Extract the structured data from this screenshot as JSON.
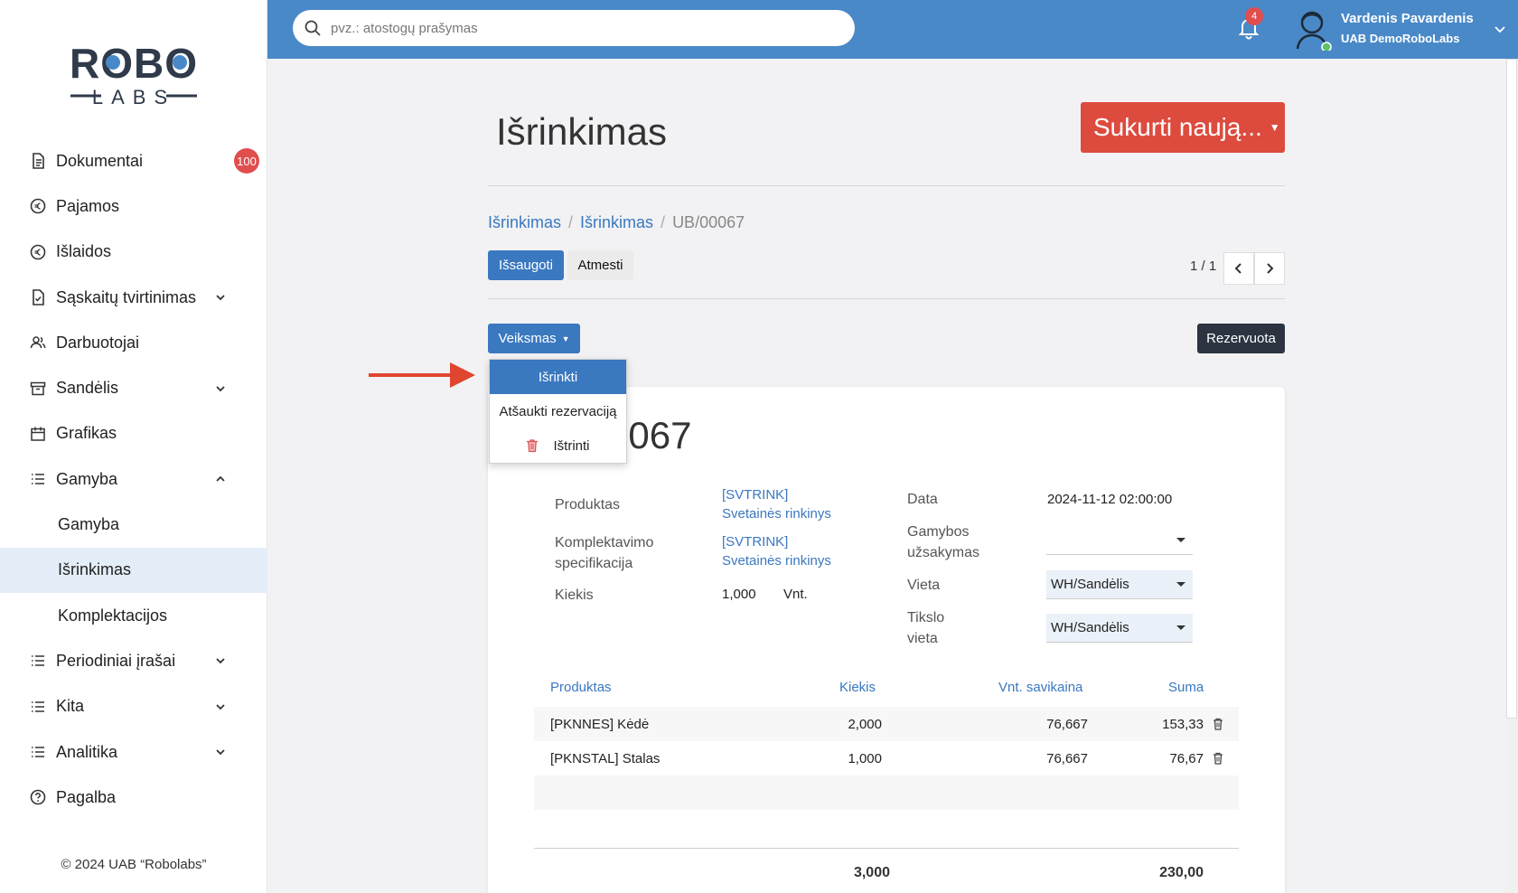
{
  "sidebar": {
    "logo": {
      "top": "ROBO",
      "bottom": "LABS"
    },
    "items": [
      {
        "label": "Dokumentai",
        "badge": "100"
      },
      {
        "label": "Pajamos"
      },
      {
        "label": "Išlaidos"
      },
      {
        "label": "Sąskaitų tvirtinimas"
      },
      {
        "label": "Darbuotojai"
      },
      {
        "label": "Sandėlis"
      },
      {
        "label": "Grafikas"
      },
      {
        "label": "Gamyba"
      },
      {
        "label": "Gamyba"
      },
      {
        "label": "Išrinkimas"
      },
      {
        "label": "Komplektacijos"
      },
      {
        "label": "Periodiniai įrašai"
      },
      {
        "label": "Kita"
      },
      {
        "label": "Analitika"
      },
      {
        "label": "Pagalba"
      }
    ],
    "footer": "© 2024 UAB “Robolabs”"
  },
  "topbar": {
    "search_placeholder": "pvz.: atostogų prašymas",
    "notifications": "4",
    "user_name": "Vardenis Pavardenis",
    "company": "UAB DemoRoboLabs"
  },
  "page": {
    "title": "Išrinkimas",
    "create_button": "Sukurti naują...",
    "breadcrumb": [
      "Išrinkimas",
      "Išrinkimas",
      "UB/00067"
    ],
    "save_button": "Išsaugoti",
    "discard_button": "Atmesti",
    "pager": "1 / 1",
    "action_button": "Veiksmas",
    "status": "Rezervuota"
  },
  "menu": {
    "items": [
      "Išrinkti",
      "Atšaukti rezervaciją",
      "Ištrinti"
    ]
  },
  "form": {
    "doc_title_partial": "0067",
    "product_label": "Produktas",
    "product_code": "[SVTRINK]",
    "product_name": "Svetainės rinkinys",
    "bom_label_1": "Komplektavimo",
    "bom_label_2": "specifikacija",
    "bom_code": "[SVTRINK]",
    "bom_name": "Svetainės rinkinys",
    "qty_label": "Kiekis",
    "qty_value": "1,000",
    "qty_unit": "Vnt.",
    "date_label": "Data",
    "date_value": "2024-11-12 02:00:00",
    "order_label_1": "Gamybos",
    "order_label_2": "užsakymas",
    "order_value": "",
    "location_label": "Vieta",
    "location_value": "WH/Sandėlis",
    "dest_label_1": "Tikslo",
    "dest_label_2": "vieta",
    "dest_value": "WH/Sandėlis"
  },
  "table": {
    "headers": [
      "Produktas",
      "Kiekis",
      "Vnt. savikaina",
      "Suma"
    ],
    "rows": [
      {
        "product": "[PKNNES] Kėdė",
        "qty": "2,000",
        "unit_cost": "76,667",
        "sum": "153,33"
      },
      {
        "product": "[PKNSTAL] Stalas",
        "qty": "1,000",
        "unit_cost": "76,667",
        "sum": "76,67"
      }
    ],
    "total_qty": "3,000",
    "total_sum": "230,00"
  },
  "colors": {
    "brand_blue": "#4a89c8",
    "primary": "#3a78c0",
    "danger": "#dd4b3e",
    "arrow": "#e0452f"
  }
}
